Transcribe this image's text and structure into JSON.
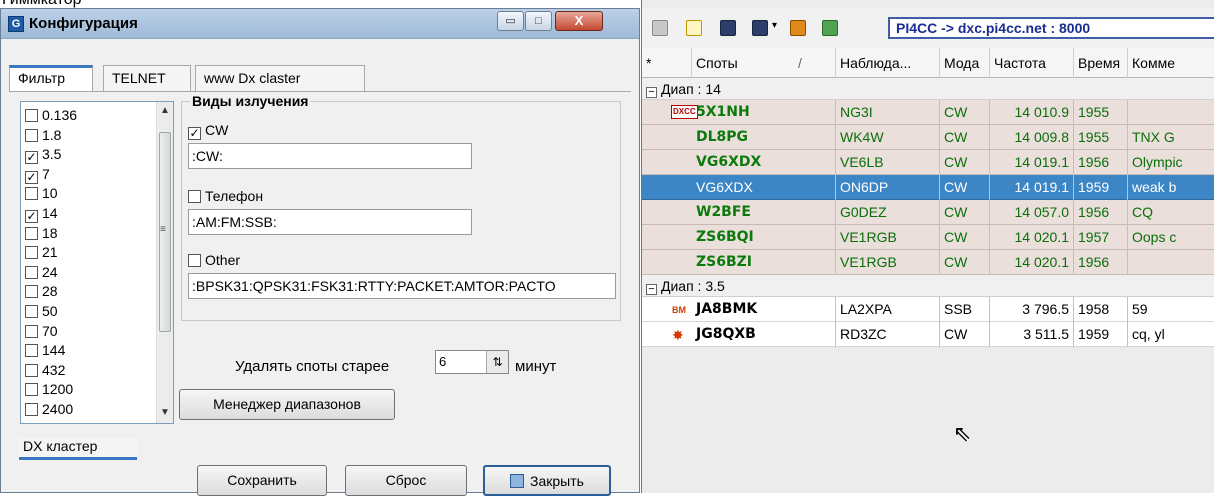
{
  "top_partial": "Гиммкатор",
  "config_window": {
    "title": "Конфигурация",
    "app_icon_letter": "G",
    "min_symbol": "▭",
    "max_symbol": "□",
    "close_symbol": "X",
    "tabs": [
      "Фильтр",
      "TELNET",
      "www Dx claster"
    ],
    "bands": [
      {
        "label": "0.136",
        "checked": false
      },
      {
        "label": "1.8",
        "checked": false
      },
      {
        "label": "3.5",
        "checked": true
      },
      {
        "label": "7",
        "checked": true
      },
      {
        "label": "10",
        "checked": false
      },
      {
        "label": "14",
        "checked": true
      },
      {
        "label": "18",
        "checked": false
      },
      {
        "label": "21",
        "checked": false
      },
      {
        "label": "24",
        "checked": false
      },
      {
        "label": "28",
        "checked": false
      },
      {
        "label": "50",
        "checked": false
      },
      {
        "label": "70",
        "checked": false
      },
      {
        "label": "144",
        "checked": false
      },
      {
        "label": "432",
        "checked": false
      },
      {
        "label": "1200",
        "checked": false
      },
      {
        "label": "2400",
        "checked": false
      }
    ],
    "emission": {
      "title": "Виды излучения",
      "cw": {
        "label": "CW",
        "checked": true,
        "value": ":CW:"
      },
      "phone": {
        "label": "Телефон",
        "checked": false,
        "value": ":AM:FM:SSB:"
      },
      "other": {
        "label": "Other",
        "checked": false,
        "value": ":BPSK31:QPSK31:FSK31:RTTY:PACKET:AMTOR:PACTO"
      }
    },
    "delete_label": "Удалять споты старее",
    "delete_value": "6",
    "delete_unit": "минут",
    "ranges_button": "Менеджер диапазонов",
    "lower_tab": "DX кластер",
    "save_button": "Сохранить",
    "reset_button": "Сброс",
    "close_button": "Закрыть"
  },
  "dx_pane": {
    "server": "PI4CC -> dxc.pi4cc.net : 8000",
    "columns": [
      "*",
      "Споты",
      "/",
      "Наблюда...",
      "Мода",
      "Частота",
      "Время",
      "Комме"
    ],
    "groups": [
      {
        "label": "Диап : 14",
        "rows": [
          {
            "call": "5X1NH",
            "obs": "NG3I",
            "mode": "CW",
            "freq": "14 010.9",
            "time": "1955",
            "comment": "",
            "icon": "DXCC",
            "style": "green"
          },
          {
            "call": "DL8PG",
            "obs": "WK4W",
            "mode": "CW",
            "freq": "14 009.8",
            "time": "1955",
            "comment": "TNX G",
            "icon": "",
            "style": "green"
          },
          {
            "call": "VG6XDX",
            "obs": "VE6LB",
            "mode": "CW",
            "freq": "14 019.1",
            "time": "1956",
            "comment": "Olympic",
            "icon": "",
            "style": "green"
          },
          {
            "call": "VG6XDX",
            "obs": "ON6DP",
            "mode": "CW",
            "freq": "14 019.1",
            "time": "1959",
            "comment": "weak b",
            "icon": "",
            "style": "sel"
          },
          {
            "call": "W2BFE",
            "obs": "G0DEZ",
            "mode": "CW",
            "freq": "14 057.0",
            "time": "1956",
            "comment": "CQ",
            "icon": "",
            "style": "green"
          },
          {
            "call": "ZS6BQI",
            "obs": "VE1RGB",
            "mode": "CW",
            "freq": "14 020.1",
            "time": "1957",
            "comment": "Oops c",
            "icon": "",
            "style": "green"
          },
          {
            "call": "ZS6BZI",
            "obs": "VE1RGB",
            "mode": "CW",
            "freq": "14 020.1",
            "time": "1956",
            "comment": "",
            "icon": "",
            "style": "green"
          }
        ]
      },
      {
        "label": "Диап : 3.5",
        "rows": [
          {
            "call": "JA8BMK",
            "obs": "LA2XPA",
            "mode": "SSB",
            "freq": "3 796.5",
            "time": "1958",
            "comment": "59",
            "icon": "BM",
            "style": "white"
          },
          {
            "call": "JG8QXB",
            "obs": "RD3ZC",
            "mode": "CW",
            "freq": "3 511.5",
            "time": "1959",
            "comment": "cq, yl",
            "icon": "✸",
            "style": "white"
          }
        ]
      }
    ]
  },
  "colors": {
    "accent": "#3a76c1",
    "selected_row": "#3d86c6",
    "spot_green": "#0b7a0b"
  }
}
